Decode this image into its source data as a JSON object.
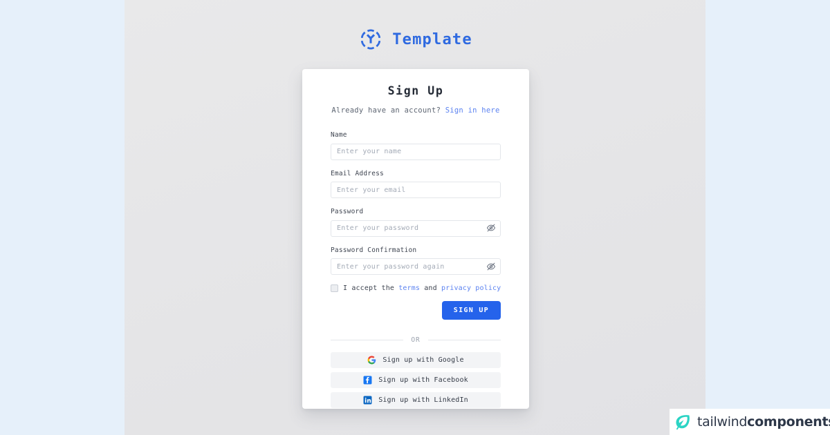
{
  "colors": {
    "outer_background": "#e6f0fa",
    "panel_background": "#e7e7e9",
    "brand_blue": "#2f6ae0",
    "link_blue": "#5b82f0",
    "button_blue": "#2563eb",
    "card_white": "#ffffff",
    "social_button_gray": "#f3f4f6",
    "watermark_teal": "#2ad4c4"
  },
  "brand": {
    "name": "Template",
    "logo_icon": "hexagon-brackets-y-icon"
  },
  "card": {
    "title": "Sign Up",
    "subtitle_prefix": "Already have an account?",
    "subtitle_link": "Sign in here"
  },
  "form": {
    "fields": [
      {
        "label": "Name",
        "placeholder": "Enter your name",
        "value": "",
        "type": "text",
        "name": "name"
      },
      {
        "label": "Email Address",
        "placeholder": "Enter your email",
        "value": "",
        "type": "email",
        "name": "email"
      },
      {
        "label": "Password",
        "placeholder": "Enter your password",
        "value": "",
        "type": "password",
        "name": "password",
        "toggle_icon": "eye-slash-icon"
      },
      {
        "label": "Password Confirmation",
        "placeholder": "Enter your password again",
        "value": "",
        "type": "password",
        "name": "password-confirmation",
        "toggle_icon": "eye-slash-icon"
      }
    ],
    "terms": {
      "checked": false,
      "prefix": "I accept the",
      "terms_link": "terms",
      "conjunction": "and",
      "privacy_link": "privacy policy"
    },
    "submit_label": "SIGN UP"
  },
  "divider": {
    "label": "OR"
  },
  "social": {
    "buttons": [
      {
        "label": "Sign up with Google",
        "icon": "google-icon",
        "provider": "google"
      },
      {
        "label": "Sign up with Facebook",
        "icon": "facebook-icon",
        "provider": "facebook"
      },
      {
        "label": "Sign up with LinkedIn",
        "icon": "linkedin-icon",
        "provider": "linkedin"
      }
    ]
  },
  "watermark": {
    "text_regular": "tailwind",
    "text_bold": "components",
    "logo_icon": "leaf-icon"
  }
}
